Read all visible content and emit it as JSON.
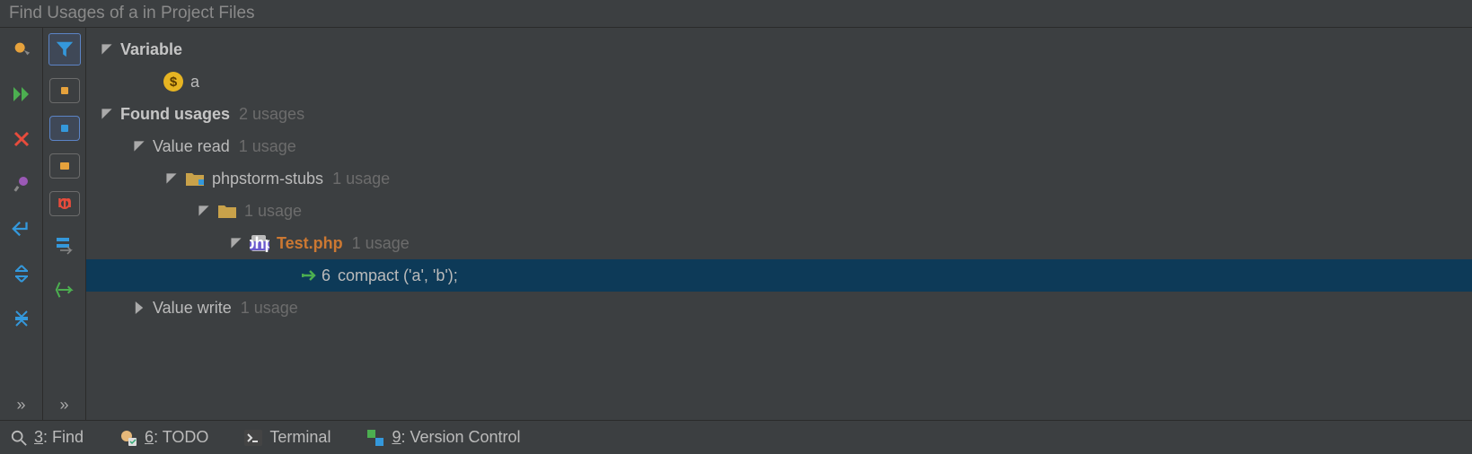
{
  "header": {
    "title": "Find Usages of  a in Project Files"
  },
  "tree": {
    "variable_label": "Variable",
    "variable_name": "a",
    "found_usages_label": "Found usages",
    "found_usages_count": "2 usages",
    "value_read_label": "Value read",
    "value_read_count": "1 usage",
    "lib_label": "phpstorm-stubs",
    "lib_count": "1 usage",
    "folder_count": "1 usage",
    "file_name": "Test.php",
    "file_count": "1 usage",
    "line_no": "6",
    "code": "compact ('a', 'b');",
    "value_write_label": "Value write",
    "value_write_count": "1 usage"
  },
  "bottom": {
    "find": "Find",
    "find_key": "3",
    "todo": "TODO",
    "todo_key": "6",
    "terminal": "Terminal",
    "vc": "Version Control",
    "vc_key": "9"
  }
}
